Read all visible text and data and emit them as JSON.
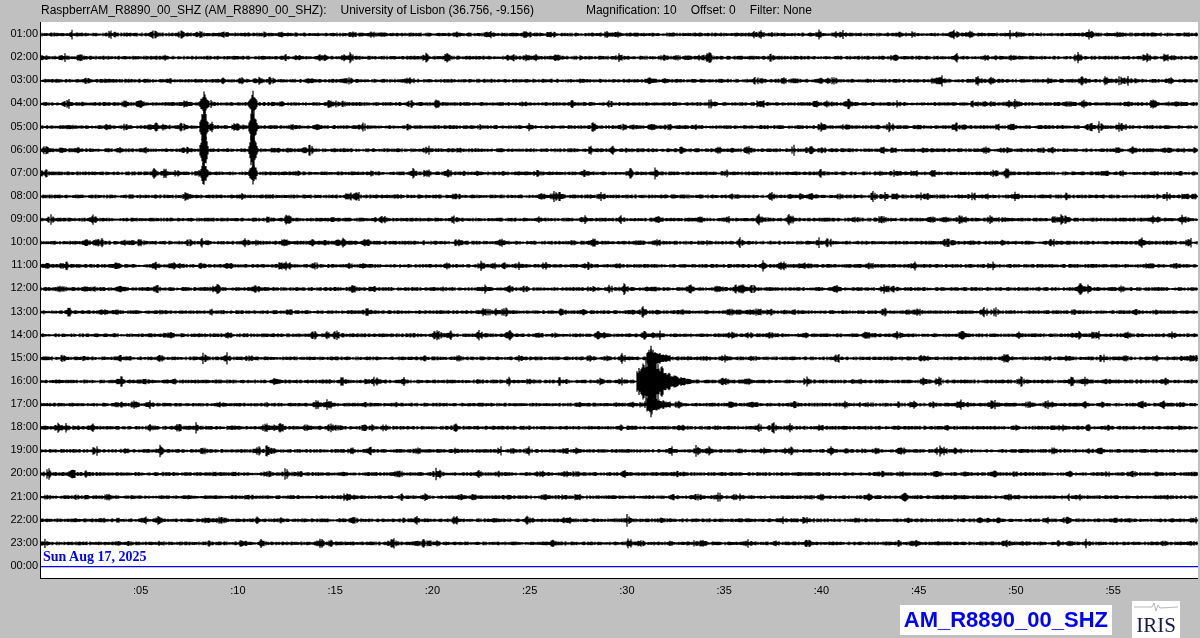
{
  "header": {
    "station": "RaspberrAM_R8890_00_SHZ (AM_R8890_00_SHZ):",
    "location": "University of Lisbon (36.756, -9.156)",
    "magnification": "Magnification: 10",
    "offset": "Offset: 0",
    "filter": "Filter: None"
  },
  "rows": [
    {
      "label": "01:00",
      "kind": "trace"
    },
    {
      "label": "02:00",
      "kind": "trace"
    },
    {
      "label": "03:00",
      "kind": "trace"
    },
    {
      "label": "04:00",
      "kind": "trace"
    },
    {
      "label": "05:00",
      "kind": "trace"
    },
    {
      "label": "06:00",
      "kind": "trace"
    },
    {
      "label": "07:00",
      "kind": "trace"
    },
    {
      "label": "08:00",
      "kind": "trace"
    },
    {
      "label": "09:00",
      "kind": "trace"
    },
    {
      "label": "10:00",
      "kind": "trace"
    },
    {
      "label": "11:00",
      "kind": "trace"
    },
    {
      "label": "12:00",
      "kind": "trace"
    },
    {
      "label": "13:00",
      "kind": "trace"
    },
    {
      "label": "14:00",
      "kind": "trace"
    },
    {
      "label": "15:00",
      "kind": "trace"
    },
    {
      "label": "16:00",
      "kind": "trace"
    },
    {
      "label": "17:00",
      "kind": "trace"
    },
    {
      "label": "18:00",
      "kind": "trace"
    },
    {
      "label": "19:00",
      "kind": "trace"
    },
    {
      "label": "20:00",
      "kind": "trace"
    },
    {
      "label": "21:00",
      "kind": "trace"
    },
    {
      "label": "22:00",
      "kind": "trace"
    },
    {
      "label": "23:00",
      "kind": "trace"
    },
    {
      "label": "00:00",
      "kind": "current"
    }
  ],
  "date": "Sun Aug 17, 2025",
  "x_ticks": [
    ":05",
    ":10",
    ":15",
    ":20",
    ":25",
    ":30",
    ":35",
    ":40",
    ":45",
    ":50",
    ":55"
  ],
  "station_label": "AM_R8890_00_SHZ",
  "logo": "IRIS"
}
